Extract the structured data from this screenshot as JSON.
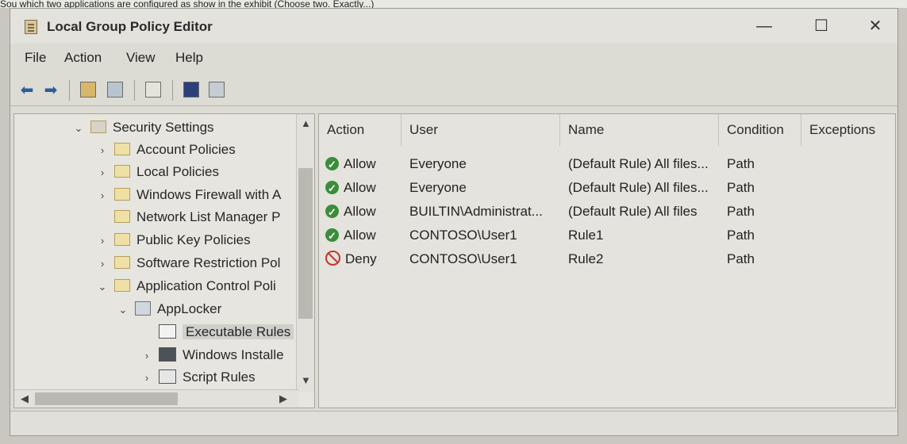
{
  "top_text": "Sou  which two applications are configured as show in the exhibit (Choose two. Exactly...)",
  "window": {
    "title": "Local Group Policy Editor"
  },
  "controls": {
    "minimize": "—",
    "maximize": "☐",
    "close": "✕"
  },
  "menu": [
    "File",
    "Action",
    "View",
    "Help"
  ],
  "tree": [
    {
      "label": "Security Settings",
      "chev": "⌄",
      "icon": "shield-folder"
    },
    {
      "label": "Account Policies",
      "chev": "›",
      "icon": "lock-folder"
    },
    {
      "label": "Local Policies",
      "chev": "›",
      "icon": "lock-folder"
    },
    {
      "label": "Windows Firewall with A",
      "chev": "›",
      "icon": "folder"
    },
    {
      "label": "Network List Manager P",
      "chev": "",
      "icon": "folder"
    },
    {
      "label": "Public Key Policies",
      "chev": "›",
      "icon": "folder"
    },
    {
      "label": "Software Restriction Pol",
      "chev": "›",
      "icon": "folder"
    },
    {
      "label": "Application Control Poli",
      "chev": "⌄",
      "icon": "folder"
    },
    {
      "label": "AppLocker",
      "chev": "⌄",
      "icon": "applocker"
    },
    {
      "label": "Executable Rules",
      "chev": "",
      "icon": "rules",
      "selected": true
    },
    {
      "label": "Windows Installe",
      "chev": "›",
      "icon": "installer"
    },
    {
      "label": "Script Rules",
      "chev": "›",
      "icon": "script"
    }
  ],
  "table": {
    "columns": [
      "Action",
      "User",
      "Name",
      "Condition",
      "Exceptions"
    ],
    "rows": [
      {
        "action": "Allow",
        "user": "Everyone",
        "name": "(Default Rule) All files...",
        "condition": "Path",
        "exceptions": ""
      },
      {
        "action": "Allow",
        "user": "Everyone",
        "name": "(Default Rule) All files...",
        "condition": "Path",
        "exceptions": ""
      },
      {
        "action": "Allow",
        "user": "BUILTIN\\Administrat...",
        "name": "(Default Rule) All files",
        "condition": "Path",
        "exceptions": ""
      },
      {
        "action": "Allow",
        "user": "CONTOSO\\User1",
        "name": "Rule1",
        "condition": "Path",
        "exceptions": ""
      },
      {
        "action": "Deny",
        "user": "CONTOSO\\User1",
        "name": "Rule2",
        "condition": "Path",
        "exceptions": ""
      }
    ]
  },
  "colors": {
    "allow": "#3a8d3a",
    "deny": "#c0392b"
  }
}
